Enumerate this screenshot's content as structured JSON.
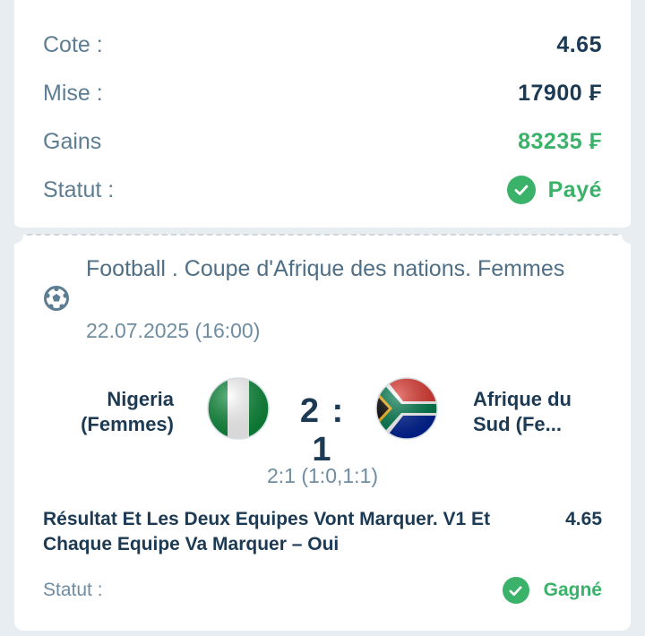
{
  "summary": {
    "odds_label": "Cote :",
    "odds_value": "4.65",
    "stake_label": "Mise :",
    "stake_value": "17900 ₣",
    "winnings_label": "Gains",
    "winnings_value": "83235 ₣",
    "status_label": "Statut :",
    "status_value": "Payé"
  },
  "event": {
    "title": "Football . Coupe d'Afrique des nations. Femmes",
    "datetime": "22.07.2025 (16:00)",
    "sport_icon": "soccer-ball-icon",
    "home_team": "Nigeria (Femmes)",
    "away_team": "Afrique du Sud (Fe...",
    "home_flag": "nigeria-flag-icon",
    "away_flag": "south-africa-flag-icon",
    "score": "2 : 1",
    "score_detail": "2:1 (1:0,1:1)"
  },
  "bet": {
    "market": "Résultat Et Les Deux Equipes Vont Marquer. V1 Et Chaque Equipe Va Marquer – Oui",
    "odds": "4.65",
    "status_label": "Statut :",
    "status_value": "Gagné"
  },
  "colors": {
    "accent_green": "#3bb26a",
    "text_dark": "#1c3a53",
    "text_muted": "#5d7d93",
    "background": "#e8edf1"
  }
}
